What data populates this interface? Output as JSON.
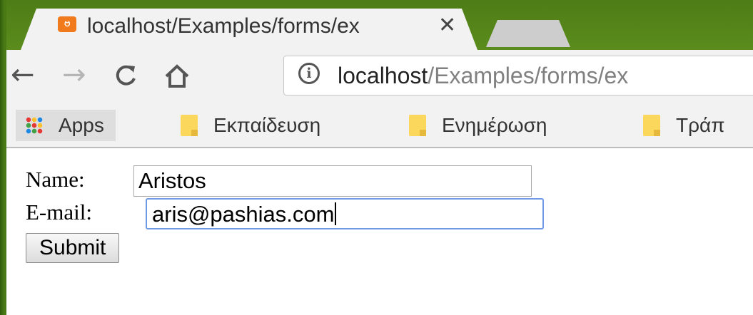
{
  "tab": {
    "title": "localhost/Examples/forms/ex",
    "favicon": "xampp-icon",
    "close": "✕"
  },
  "toolbar": {
    "back": "←",
    "forward": "→",
    "reload": "C",
    "home": "⌂",
    "info": "i",
    "url_host": "localhost",
    "url_path": "/Examples/forms/ex"
  },
  "bookmarks": {
    "apps_label": "Apps",
    "items": [
      {
        "label": "Εκπαίδευση"
      },
      {
        "label": "Ενημέρωση"
      },
      {
        "label": "Τράπ"
      }
    ]
  },
  "form": {
    "name_label": "Name:",
    "name_value": "Aristos",
    "email_label": "E-mail:",
    "email_value": "aris@pashias.com",
    "submit_label": "Submit"
  },
  "colors": {
    "desktop_green": "#4a7a14",
    "favicon_orange": "#f07a1c",
    "focus_blue": "#6f9ae4",
    "folder_yellow": "#fbd85c"
  }
}
